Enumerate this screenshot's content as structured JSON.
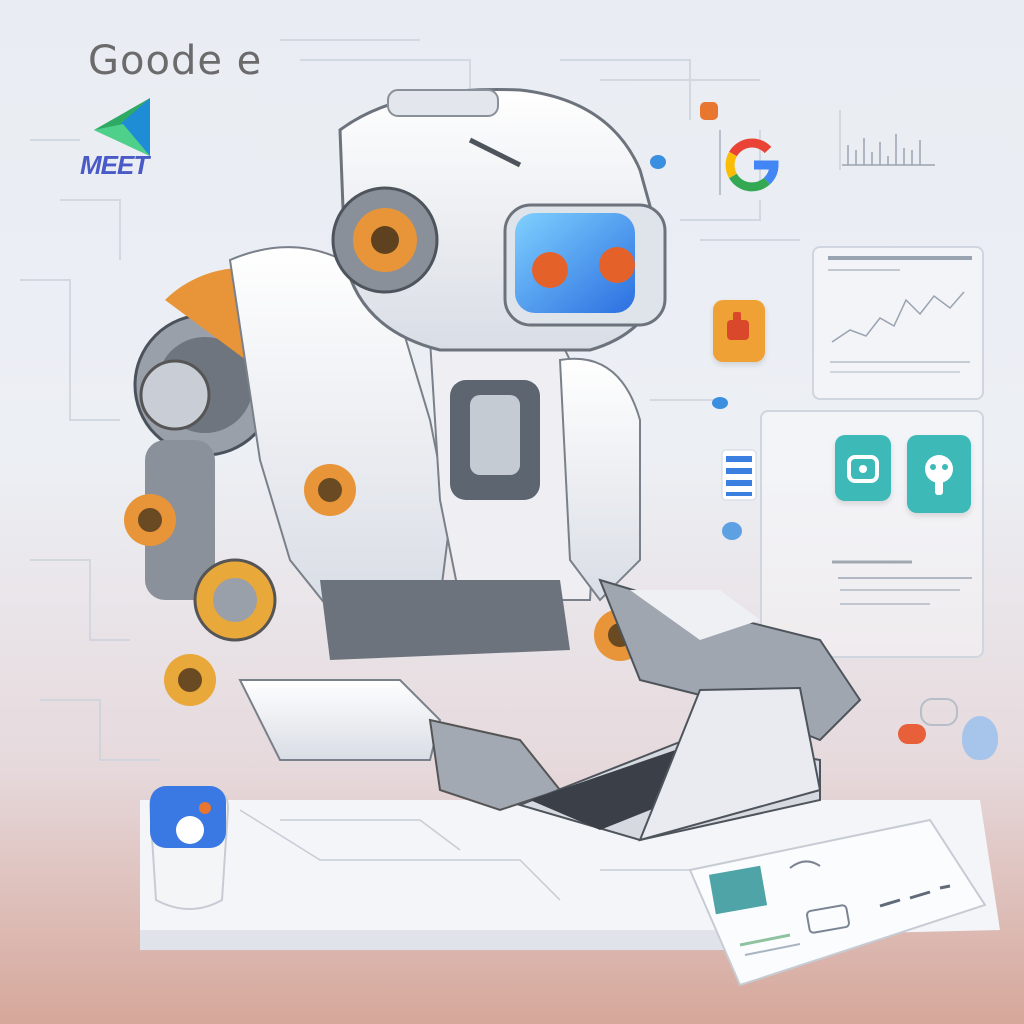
{
  "header": {
    "brand_text": "Goode e",
    "meet_label": "MEET"
  },
  "colors": {
    "robot_white": "#f2f3f6",
    "robot_orange": "#e8953a",
    "visor_blue": "#3b8fe0",
    "eye_orange": "#e4622a",
    "teal_tile": "#3dbab8",
    "google_red": "#ea4335",
    "google_blue": "#4285f4",
    "google_yellow": "#fbbc05",
    "google_green": "#34a853"
  },
  "icons": [
    "google-g-icon",
    "document-icon",
    "lock-tile-icon",
    "plug-tile-icon",
    "list-icon",
    "chat-bubble-icon",
    "meet-logo-icon"
  ]
}
